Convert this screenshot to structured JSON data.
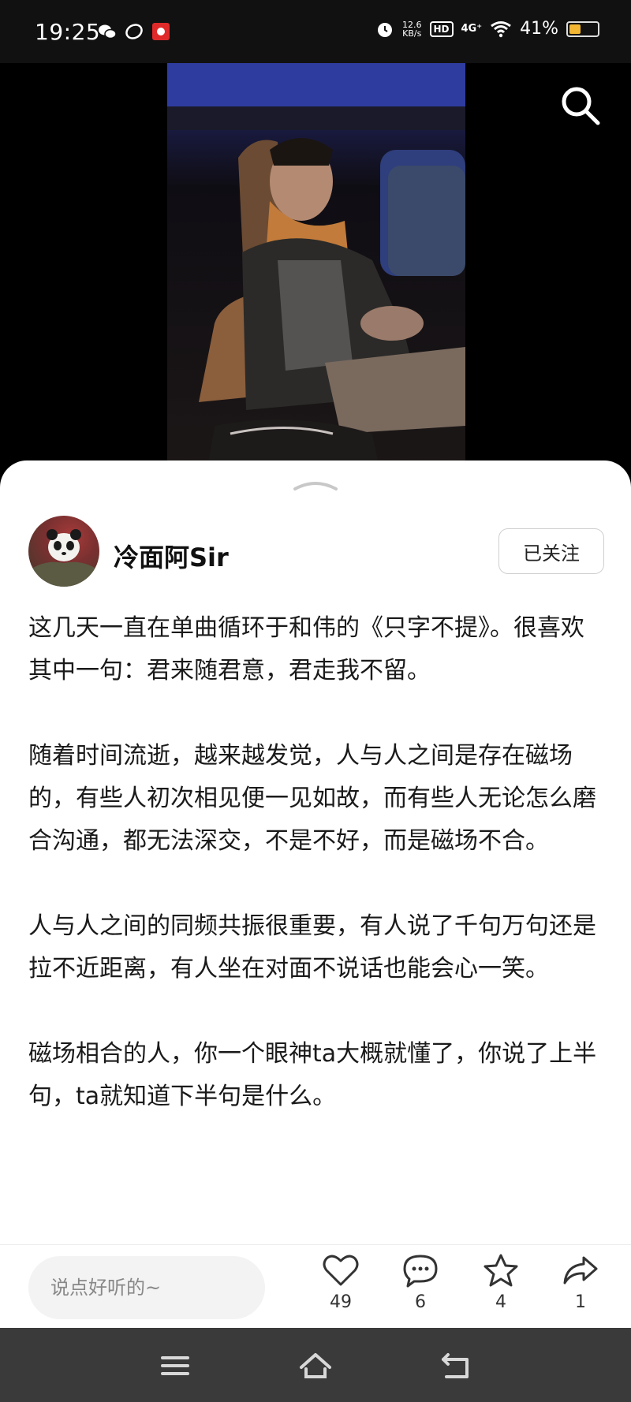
{
  "status_bar": {
    "time": "19:25",
    "speed": "12.6",
    "speed_unit": "KB/s",
    "hd": "HD",
    "network": "4G⁺",
    "battery_percent": "41%",
    "battery_level": 0.41
  },
  "post": {
    "author": "冷面阿Sir",
    "follow_label": "已关注",
    "paragraphs": [
      "这几天一直在单曲循环于和伟的《只字不提》。很喜欢其中一句：君来随君意，君走我不留。",
      "随着时间流逝，越来越发觉，人与人之间是存在磁场的，有些人初次相见便一见如故，而有些人无论怎么磨合沟通，都无法深交，不是不好，而是磁场不合。",
      "人与人之间的同频共振很重要，有人说了千句万句还是拉不近距离，有人坐在对面不说话也能会心一笑。",
      "磁场相合的人，你一个眼神ta大概就懂了，你说了上半句，ta就知道下半句是什么。"
    ]
  },
  "actions": {
    "comment_placeholder": "说点好听的~",
    "like_count": "49",
    "comment_count": "6",
    "favorite_count": "4",
    "share_count": "1"
  },
  "colors": {
    "battery": "#f2b632",
    "nav_bar": "#3a3a3a"
  }
}
